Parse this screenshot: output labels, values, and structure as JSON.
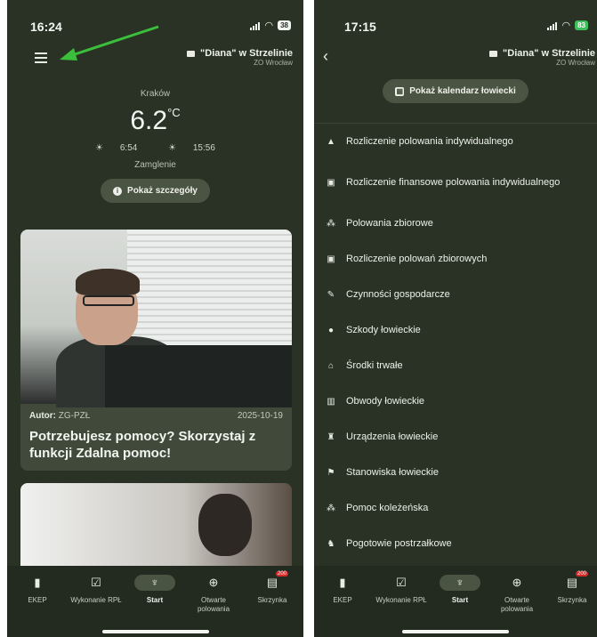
{
  "left": {
    "time": "16:24",
    "battery": "38",
    "club_name": "\"Diana\" w Strzelinie",
    "club_sub": "ZO Wrocław",
    "weather": {
      "city": "Kraków",
      "temp": "6.2",
      "unit": "°C",
      "sunrise": "6:54",
      "sunset": "15:56",
      "desc": "Zamglenie",
      "details_label": "Pokaż szczegóły"
    },
    "news": {
      "author_label": "Autor:",
      "author": "ZG-PZŁ",
      "date": "2025-10-19",
      "title": "Potrzebujesz pomocy? Skorzystaj z funkcji Zdalna pomoc!"
    }
  },
  "right": {
    "time": "17:15",
    "battery": "83",
    "club_name": "\"Diana\" w Strzelinie",
    "club_sub": "ZO Wrocław",
    "calendar_label": "Pokaż kalendarz łowiecki",
    "menu": [
      {
        "label": "Rozliczenie polowania indywidualnego",
        "icon": "person-icon"
      },
      {
        "label": "Rozliczenie finansowe polowania indywidualnego",
        "icon": "finance-icon"
      },
      {
        "label": "Polowania zbiorowe",
        "icon": "group-icon"
      },
      {
        "label": "Rozliczenie polowań zbiorowych",
        "icon": "finance-icon"
      },
      {
        "label": "Czynności gospodarcze",
        "icon": "tools-icon"
      },
      {
        "label": "Szkody łowieckie",
        "icon": "alert-icon"
      },
      {
        "label": "Środki trwałe",
        "icon": "asset-icon"
      },
      {
        "label": "Obwody łowieckie",
        "icon": "map-icon"
      },
      {
        "label": "Urządzenia łowieckie",
        "icon": "tower-icon"
      },
      {
        "label": "Stanowiska łowieckie",
        "icon": "flag-icon"
      },
      {
        "label": "Pomoc koleżeńska",
        "icon": "group-icon"
      },
      {
        "label": "Pogotowie postrzałkowe",
        "icon": "dog-icon"
      }
    ]
  },
  "tabs": [
    {
      "label": "EKEP",
      "icon": "book-icon"
    },
    {
      "label": "Wykonanie RPŁ",
      "icon": "calendar-icon"
    },
    {
      "label": "Start",
      "icon": "emblem-icon"
    },
    {
      "label": "Otwarte polowania",
      "icon": "crosshair-icon"
    },
    {
      "label": "Skrzynka",
      "icon": "inbox-icon",
      "badge": "200"
    }
  ],
  "colors": {
    "background": "#2a3226",
    "accent": "#4a5442",
    "arrow": "#3bbf3b"
  }
}
